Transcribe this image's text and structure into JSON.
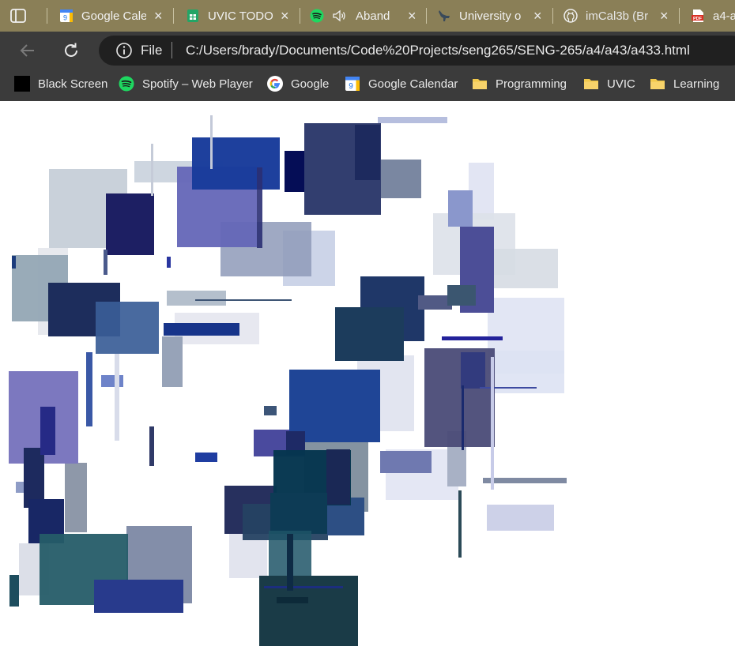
{
  "tabs": [
    {
      "title": "Google Cale",
      "icon": "google-calendar-icon"
    },
    {
      "title": "UVIC TODO",
      "icon": "google-sheets-icon"
    },
    {
      "title": "Aband",
      "icon": "spotify-icon",
      "audio": "speaker-icon"
    },
    {
      "title": "University o",
      "icon": "dinosaur-icon"
    },
    {
      "title": "imCal3b (Br",
      "icon": "github-icon"
    },
    {
      "title": "a4-a",
      "icon": "pdf-icon"
    }
  ],
  "address_bar": {
    "scheme": "File",
    "url": "C:/Users/brady/Documents/Code%20Projects/seng265/SENG-265/a4/a43/a433.html"
  },
  "bookmarks": [
    {
      "label": "Black Screen",
      "icon": "black-square-icon"
    },
    {
      "label": "Spotify – Web Player",
      "icon": "spotify-icon"
    },
    {
      "label": "Google",
      "icon": "google-g-icon"
    },
    {
      "label": "Google Calendar",
      "icon": "google-calendar-icon"
    },
    {
      "label": "Programming",
      "icon": "folder-icon"
    },
    {
      "label": "UVIC",
      "icon": "folder-icon"
    },
    {
      "label": "Learning",
      "icon": "folder-icon"
    }
  ],
  "colors": {
    "tab_bar": "#8a7f57",
    "toolbar": "#3b3b3b",
    "omnibox": "#202020"
  }
}
